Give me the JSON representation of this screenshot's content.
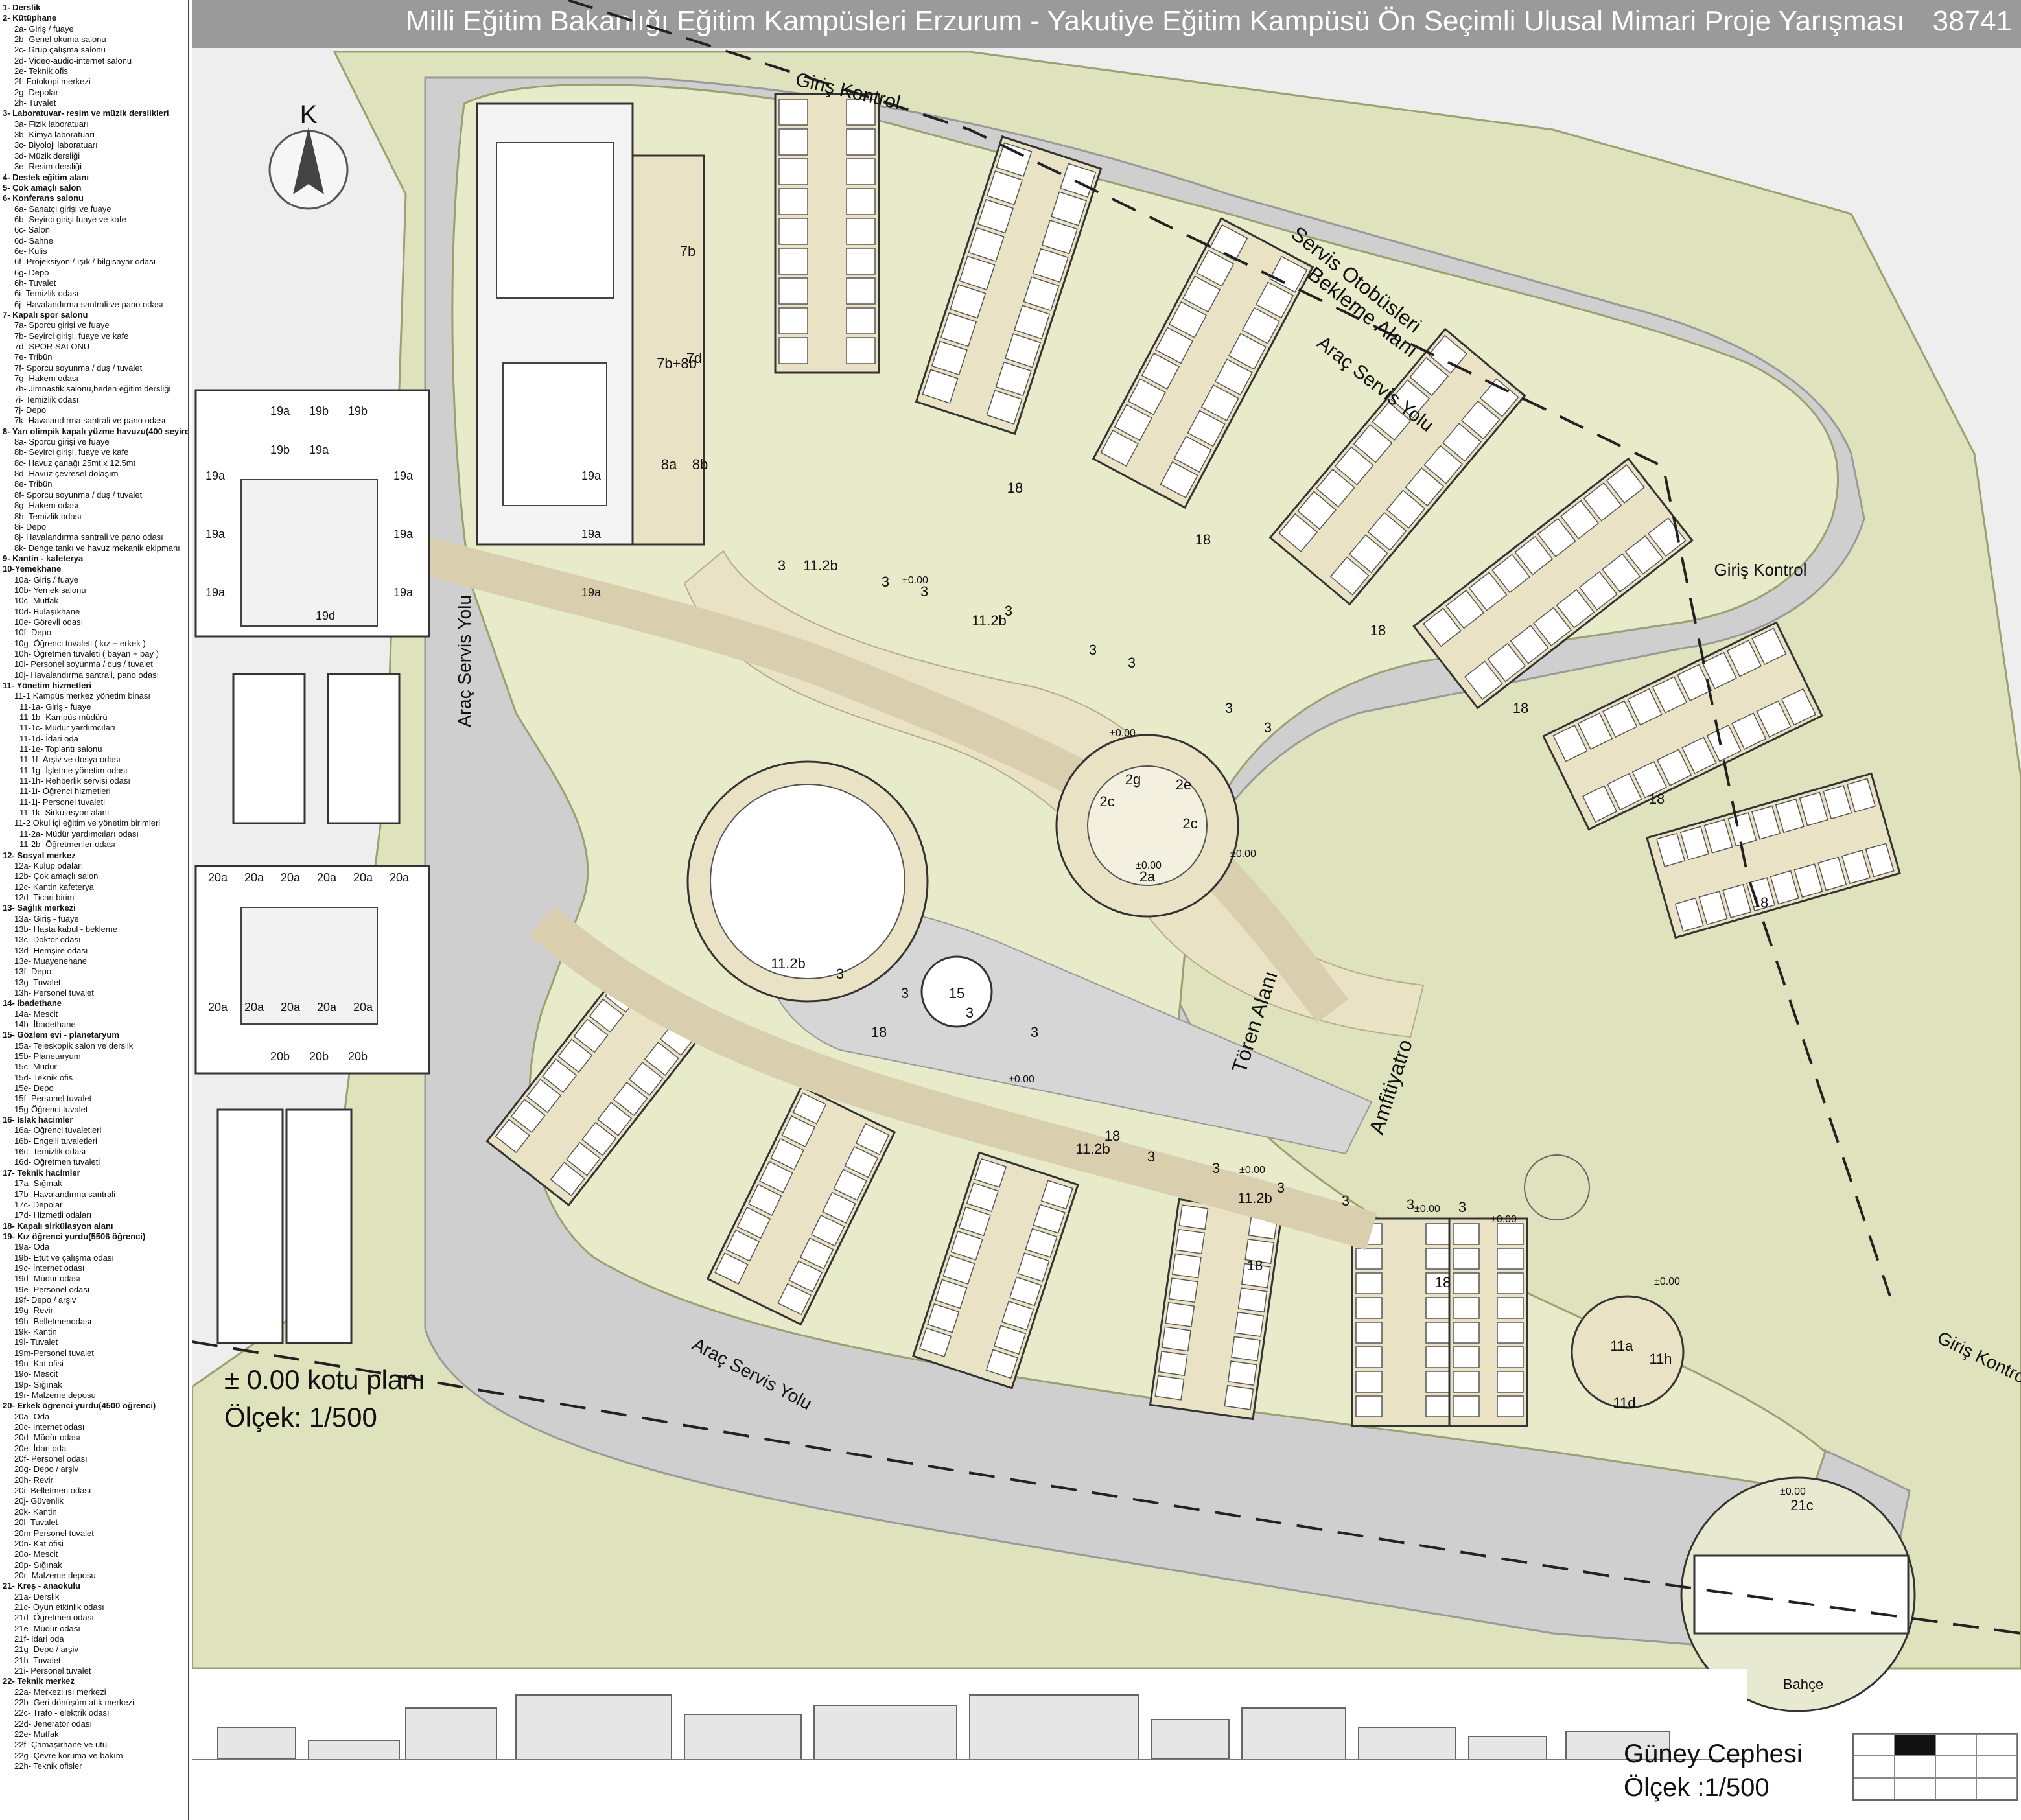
{
  "title": "Milli Eğitim Bakanlığı Eğitim Kampüsleri  Erzurum - Yakutiye Eğitim Kampüsü Ön Seçimli Ulusal Mimari Proje Yarışması",
  "project_number": "38741",
  "north_label": "K",
  "plan_title": "± 0.00 kotu planı",
  "plan_scale": "Ölçek: 1/500",
  "elevation_title": "Güney Cephesi",
  "elevation_scale": "Ölçek :1/500",
  "site_labels": {
    "giris_kontrol_top": "Giriş Kontrol",
    "giris_kontrol_right": "Giriş Kontrol",
    "giris_kontrol_bottom": "Giriş Kontrol",
    "servis_otobusleri": "Servis Otobüsleri",
    "bekleme_alani": "Bekleme Alanı",
    "arac_servis_yolu_ne": "Araç Servis Yolu",
    "arac_servis_yolu_west": "Araç Servis Yolu",
    "arac_servis_yolu_south": "Araç Servis Yolu",
    "toren_alani": "Tören Alanı",
    "amfitiyatro": "Amfitiyatro"
  },
  "room_labels": [
    "3",
    "11.2b",
    "3",
    "3",
    "3",
    "11.2b",
    "3",
    "3",
    "3",
    "3",
    "18",
    "18",
    "18",
    "18",
    "18",
    "18",
    "7b",
    "7d",
    "7b+8b",
    "8a",
    "8b",
    "2a",
    "2g",
    "2e",
    "2c",
    "2c",
    "15",
    "11.2b",
    "3",
    "3",
    "3",
    "3",
    "11.2b",
    "3",
    "3",
    "3",
    "11.2b",
    "3",
    "3",
    "3",
    "18",
    "18",
    "18",
    "18",
    "11a",
    "11h",
    "11d",
    "21c",
    "Bahçe"
  ],
  "dorm_labels": [
    "19a",
    "19b",
    "19b",
    "19b",
    "19a",
    "19a",
    "19a",
    "19a",
    "19a",
    "19a",
    "19a",
    "19a",
    "19a",
    "19a",
    "19d",
    "20a",
    "20a",
    "20a",
    "20a",
    "20a",
    "20a",
    "20a",
    "20a",
    "20a",
    "20a",
    "20a",
    "20b",
    "20b",
    "20b"
  ],
  "level_marks": [
    "±0.00",
    "±0.00",
    "±0.00",
    "±0.00",
    "±0.00",
    "±0.00",
    "±0.00",
    "±0.00",
    "±0.00",
    "±0.00"
  ],
  "legend_items": [
    {
      "text": "1- Derslik",
      "level": 0
    },
    {
      "text": "2- Kütüphane",
      "level": 0
    },
    {
      "text": "2a- Giriş / fuaye",
      "level": 1
    },
    {
      "text": "2b- Genel okuma salonu",
      "level": 1
    },
    {
      "text": "2c- Grup çalışma salonu",
      "level": 1
    },
    {
      "text": "2d- Video-audio-internet salonu",
      "level": 1
    },
    {
      "text": "2e- Teknik ofis",
      "level": 1
    },
    {
      "text": "2f- Fotokopi merkezi",
      "level": 1
    },
    {
      "text": "2g- Depolar",
      "level": 1
    },
    {
      "text": "2h- Tuvalet",
      "level": 1
    },
    {
      "text": "3- Laboratuvar- resim ve müzik derslikleri",
      "level": 0
    },
    {
      "text": "3a- Fizik laboratuarı",
      "level": 1
    },
    {
      "text": "3b- Kimya laboratuarı",
      "level": 1
    },
    {
      "text": "3c- Biyoloji laboratuarı",
      "level": 1
    },
    {
      "text": "3d- Müzik dersliği",
      "level": 1
    },
    {
      "text": "3e- Resim dersliği",
      "level": 1
    },
    {
      "text": "4- Destek eğitim alanı",
      "level": 0
    },
    {
      "text": "5- Çok amaçlı salon",
      "level": 0
    },
    {
      "text": "6- Konferans salonu",
      "level": 0
    },
    {
      "text": "6a- Sanatçı girişi ve fuaye",
      "level": 1
    },
    {
      "text": "6b- Seyirci girişi fuaye ve kafe",
      "level": 1
    },
    {
      "text": "6c- Salon",
      "level": 1
    },
    {
      "text": "6d- Sahne",
      "level": 1
    },
    {
      "text": "6e- Kulis",
      "level": 1
    },
    {
      "text": "6f- Projeksiyon / ışık / bilgisayar odası",
      "level": 1
    },
    {
      "text": "6g- Depo",
      "level": 1
    },
    {
      "text": "6h- Tuvalet",
      "level": 1
    },
    {
      "text": "6i- Temizlik odası",
      "level": 1
    },
    {
      "text": "6j- Havalandırma santrali ve pano odası",
      "level": 1
    },
    {
      "text": "7- Kapalı spor salonu",
      "level": 0
    },
    {
      "text": "7a- Sporcu girişi ve fuaye",
      "level": 1
    },
    {
      "text": "7b- Seyirci girişi, fuaye ve kafe",
      "level": 1
    },
    {
      "text": "7d- SPOR SALONU",
      "level": 1
    },
    {
      "text": "7e- Tribün",
      "level": 1
    },
    {
      "text": "7f- Sporcu soyunma / duş / tuvalet",
      "level": 1
    },
    {
      "text": "7g- Hakem odası",
      "level": 1
    },
    {
      "text": "7h- Jimnastik salonu,beden eğitim dersliği",
      "level": 1
    },
    {
      "text": "7i- Temizlik odası",
      "level": 1
    },
    {
      "text": "7j- Depo",
      "level": 1
    },
    {
      "text": "7k- Havalandırma santrali ve pano odası",
      "level": 1
    },
    {
      "text": "8- Yarı olimpik kapalı yüzme havuzu(400 seyirci)",
      "level": 0
    },
    {
      "text": "8a- Sporcu girişi ve fuaye",
      "level": 1
    },
    {
      "text": "8b- Seyirci girişi, fuaye ve kafe",
      "level": 1
    },
    {
      "text": "8c- Havuz çanağı 25mt x 12.5mt",
      "level": 1
    },
    {
      "text": "8d- Havuz çevresel dolaşım",
      "level": 1
    },
    {
      "text": "8e- Tribün",
      "level": 1
    },
    {
      "text": "8f- Sporcu soyunma / duş / tuvalet",
      "level": 1
    },
    {
      "text": "8g- Hakem odası",
      "level": 1
    },
    {
      "text": "8h- Temizlik odası",
      "level": 1
    },
    {
      "text": "8i- Depo",
      "level": 1
    },
    {
      "text": "8j- Havalandırma santrali ve pano odası",
      "level": 1
    },
    {
      "text": "8k- Denge tankı ve havuz mekanik ekipmanı",
      "level": 1
    },
    {
      "text": "9- Kantin - kafeterya",
      "level": 0
    },
    {
      "text": "10-Yemekhane",
      "level": 0
    },
    {
      "text": "10a- Giriş / fuaye",
      "level": 1
    },
    {
      "text": "10b- Yemek salonu",
      "level": 1
    },
    {
      "text": "10c- Mutfak",
      "level": 1
    },
    {
      "text": "10d- Bulaşıkhane",
      "level": 1
    },
    {
      "text": "10e- Görevli odası",
      "level": 1
    },
    {
      "text": "10f- Depo",
      "level": 1
    },
    {
      "text": "10g- Öğrenci tuvaleti ( kız + erkek )",
      "level": 1
    },
    {
      "text": "10h- Öğretmen tuvaleti ( bayan + bay )",
      "level": 1
    },
    {
      "text": "10i- Personel soyunma / duş / tuvalet",
      "level": 1
    },
    {
      "text": "10j- Havalandırma santrali, pano odası",
      "level": 1
    },
    {
      "text": "11- Yönetim hizmetleri",
      "level": 0
    },
    {
      "text": "11-1 Kampüs merkez yönetim binası",
      "level": 1
    },
    {
      "text": "11-1a- Giriş - fuaye",
      "level": 2
    },
    {
      "text": "11-1b- Kampüs müdürü",
      "level": 2
    },
    {
      "text": "11-1c- Müdür yardımcıları",
      "level": 2
    },
    {
      "text": "11-1d- İdari oda",
      "level": 2
    },
    {
      "text": "11-1e- Toplantı salonu",
      "level": 2
    },
    {
      "text": "11-1f- Arşiv ve dosya odası",
      "level": 2
    },
    {
      "text": "11-1g- İşletme yönetim odası",
      "level": 2
    },
    {
      "text": "11-1h- Rehberlik servisi odası",
      "level": 2
    },
    {
      "text": "11-1i- Öğrenci hizmetleri",
      "level": 2
    },
    {
      "text": "11-1j- Personel tuvaleti",
      "level": 2
    },
    {
      "text": "11-1k- Sirkülasyon alanı",
      "level": 2
    },
    {
      "text": "11-2 Okul içi eğitim ve yönetim birimleri",
      "level": 1
    },
    {
      "text": "11-2a- Müdür yardımcıları odası",
      "level": 2
    },
    {
      "text": "11-2b- Öğretmenler odası",
      "level": 2
    },
    {
      "text": "12- Sosyal merkez",
      "level": 0
    },
    {
      "text": "12a- Kulüp odaları",
      "level": 1
    },
    {
      "text": "12b- Çok amaçlı salon",
      "level": 1
    },
    {
      "text": "12c- Kantin kafeterya",
      "level": 1
    },
    {
      "text": "12d- Ticari birim",
      "level": 1
    },
    {
      "text": "13- Sağlık merkezi",
      "level": 0
    },
    {
      "text": "13a- Giriş - fuaye",
      "level": 1
    },
    {
      "text": "13b- Hasta kabul - bekleme",
      "level": 1
    },
    {
      "text": "13c- Doktor odası",
      "level": 1
    },
    {
      "text": "13d- Hemşire odası",
      "level": 1
    },
    {
      "text": "13e- Muayenehane",
      "level": 1
    },
    {
      "text": "13f- Depo",
      "level": 1
    },
    {
      "text": "13g- Tuvalet",
      "level": 1
    },
    {
      "text": "13h- Personel tuvalet",
      "level": 1
    },
    {
      "text": "14- İbadethane",
      "level": 0
    },
    {
      "text": "14a- Mescit",
      "level": 1
    },
    {
      "text": "14b- İbadethane",
      "level": 1
    },
    {
      "text": "15- Gözlem evi - planetaryum",
      "level": 0
    },
    {
      "text": "15a- Teleskopik salon ve derslik",
      "level": 1
    },
    {
      "text": "15b- Planetaryum",
      "level": 1
    },
    {
      "text": "15c- Müdür",
      "level": 1
    },
    {
      "text": "15d- Teknik ofis",
      "level": 1
    },
    {
      "text": "15e- Depo",
      "level": 1
    },
    {
      "text": "15f- Personel tuvalet",
      "level": 1
    },
    {
      "text": "15g-Öğrenci tuvalet",
      "level": 1
    },
    {
      "text": "16- Islak hacimler",
      "level": 0
    },
    {
      "text": "16a- Öğrenci tuvaletleri",
      "level": 1
    },
    {
      "text": "16b- Engelli tuvaletleri",
      "level": 1
    },
    {
      "text": "16c- Temizlik odası",
      "level": 1
    },
    {
      "text": "16d- Öğretmen tuvaleti",
      "level": 1
    },
    {
      "text": "17- Teknik hacimler",
      "level": 0
    },
    {
      "text": "17a- Sığınak",
      "level": 1
    },
    {
      "text": "17b- Havalandırma santrali",
      "level": 1
    },
    {
      "text": "17c- Depolar",
      "level": 1
    },
    {
      "text": "17d- Hizmetli odaları",
      "level": 1
    },
    {
      "text": "18- Kapalı sirkülasyon alanı",
      "level": 0
    },
    {
      "text": "19- Kız öğrenci yurdu(5506 öğrenci)",
      "level": 0
    },
    {
      "text": "19a- Oda",
      "level": 1
    },
    {
      "text": "19b- Etüt ve çalışma odası",
      "level": 1
    },
    {
      "text": "19c- İnternet odası",
      "level": 1
    },
    {
      "text": "19d- Müdür odası",
      "level": 1
    },
    {
      "text": "19e- Personel odası",
      "level": 1
    },
    {
      "text": "19f- Depo / arşiv",
      "level": 1
    },
    {
      "text": "19g- Revir",
      "level": 1
    },
    {
      "text": "19h- Belletmenodası",
      "level": 1
    },
    {
      "text": "19k- Kantin",
      "level": 1
    },
    {
      "text": "19l- Tuvalet",
      "level": 1
    },
    {
      "text": "19m-Personel tuvalet",
      "level": 1
    },
    {
      "text": "19n- Kat ofisi",
      "level": 1
    },
    {
      "text": "19o- Mescit",
      "level": 1
    },
    {
      "text": "19p- Sığınak",
      "level": 1
    },
    {
      "text": "19r- Malzeme deposu",
      "level": 1
    },
    {
      "text": "20- Erkek öğrenci yurdu(4500 öğrenci)",
      "level": 0
    },
    {
      "text": "20a- Oda",
      "level": 1
    },
    {
      "text": "20c- İnternet odası",
      "level": 1
    },
    {
      "text": "20d- Müdür odası",
      "level": 1
    },
    {
      "text": "20e- İdari oda",
      "level": 1
    },
    {
      "text": "20f- Personel odası",
      "level": 1
    },
    {
      "text": "20g- Depo / arşiv",
      "level": 1
    },
    {
      "text": "20h- Revir",
      "level": 1
    },
    {
      "text": "20i- Belletmen odası",
      "level": 1
    },
    {
      "text": "20j- Güvenlik",
      "level": 1
    },
    {
      "text": "20k- Kantin",
      "level": 1
    },
    {
      "text": "20l- Tuvalet",
      "level": 1
    },
    {
      "text": "20m-Personel tuvalet",
      "level": 1
    },
    {
      "text": "20n- Kat ofisi",
      "level": 1
    },
    {
      "text": "20o- Mescit",
      "level": 1
    },
    {
      "text": "20p- Sığınak",
      "level": 1
    },
    {
      "text": "20r- Malzeme deposu",
      "level": 1
    },
    {
      "text": "21- Kreş - anaokulu",
      "level": 0
    },
    {
      "text": "21a- Derslik",
      "level": 1
    },
    {
      "text": "21c- Oyun etkinlik odası",
      "level": 1
    },
    {
      "text": "21d- Öğretmen odası",
      "level": 1
    },
    {
      "text": "21e- Müdür odası",
      "level": 1
    },
    {
      "text": "21f- İdari oda",
      "level": 1
    },
    {
      "text": "21g- Depo / arşiv",
      "level": 1
    },
    {
      "text": "21h- Tuvalet",
      "level": 1
    },
    {
      "text": "21i- Personel tuvalet",
      "level": 1
    },
    {
      "text": "22- Teknik merkez",
      "level": 0
    },
    {
      "text": "22a- Merkezi ısı merkezi",
      "level": 1
    },
    {
      "text": "22b- Geri dönüşüm atık merkezi",
      "level": 1
    },
    {
      "text": "22c- Trafo - elektrik odası",
      "level": 1
    },
    {
      "text": "22d- Jeneratör odası",
      "level": 1
    },
    {
      "text": "22e- Mutfak",
      "level": 1
    },
    {
      "text": "22f- Çamaşırhane ve ütü",
      "level": 1
    },
    {
      "text": "22g- Çevre koruma ve bakım",
      "level": 1
    },
    {
      "text": "22h- Teknik ofisler",
      "level": 1
    }
  ],
  "colors": {
    "title_bar": "#9a9a9a",
    "grass": "#dfe3bd",
    "grass_dark": "#cfd59e",
    "path": "#e9e2c5",
    "road": "#cfcfcf",
    "building": "#ffffff",
    "wall": "#333333",
    "courtyard": "#e4e7cf"
  }
}
